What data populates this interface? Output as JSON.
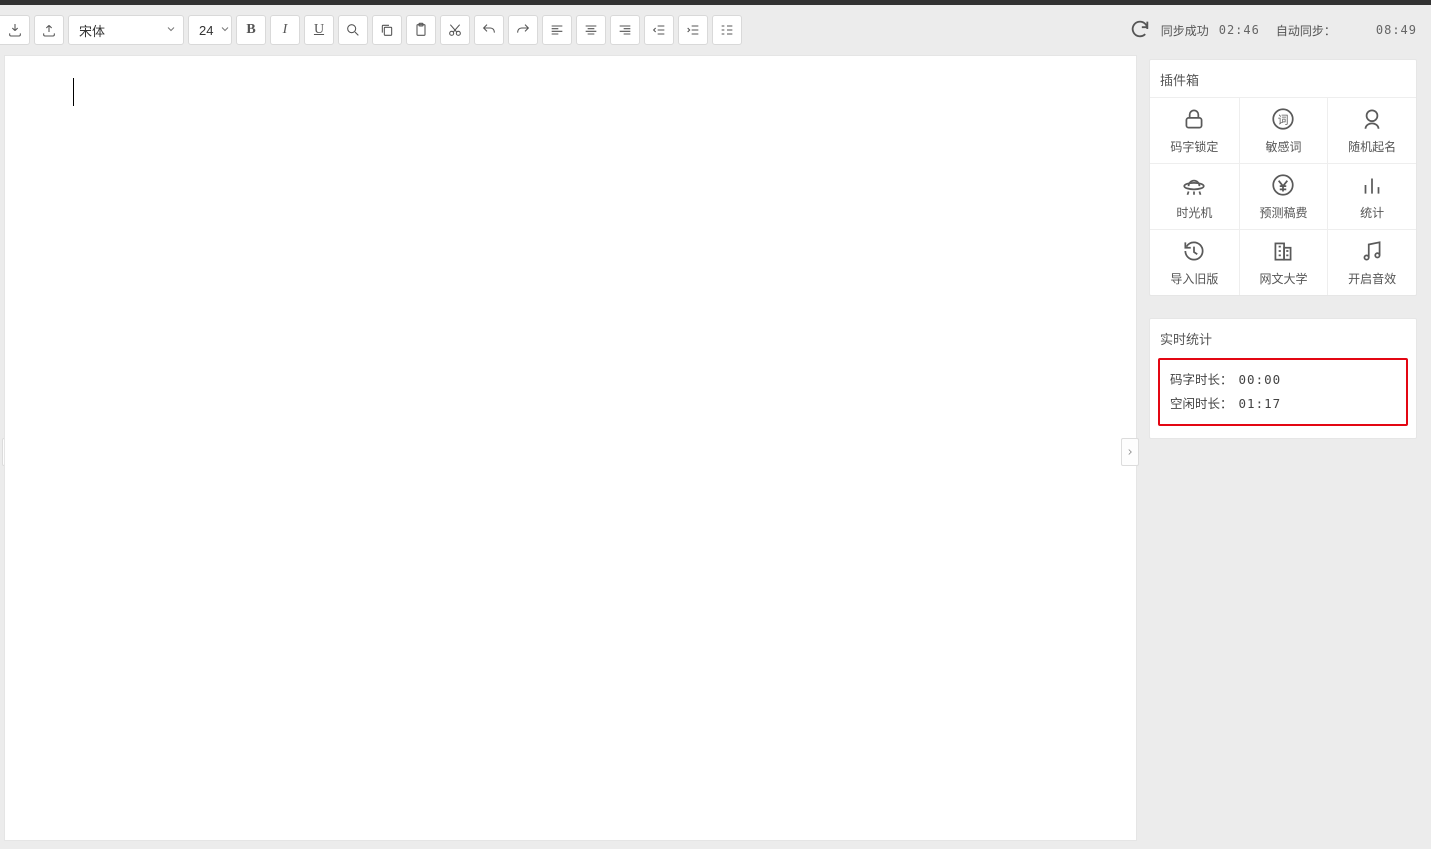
{
  "toolbar": {
    "font_name": "宋体",
    "font_size": "24"
  },
  "sync": {
    "status_label": "同步成功",
    "last_sync_time": "02:46",
    "auto_label": "自动同步：",
    "clock": "08:49"
  },
  "plugin_panel": {
    "title": "插件箱",
    "items": [
      {
        "id": "lock",
        "label": "码字锁定"
      },
      {
        "id": "sensitive",
        "label": "敏感词"
      },
      {
        "id": "random",
        "label": "随机起名"
      },
      {
        "id": "time",
        "label": "时光机"
      },
      {
        "id": "fee",
        "label": "预测稿费"
      },
      {
        "id": "stats",
        "label": "统计"
      },
      {
        "id": "import",
        "label": "导入旧版"
      },
      {
        "id": "school",
        "label": "网文大学"
      },
      {
        "id": "sound",
        "label": "开启音效"
      }
    ]
  },
  "live_stats": {
    "title": "实时统计",
    "typing_label": "码字时长：",
    "typing_value": "00:00",
    "idle_label": "空闲时长：",
    "idle_value": "01:17"
  }
}
